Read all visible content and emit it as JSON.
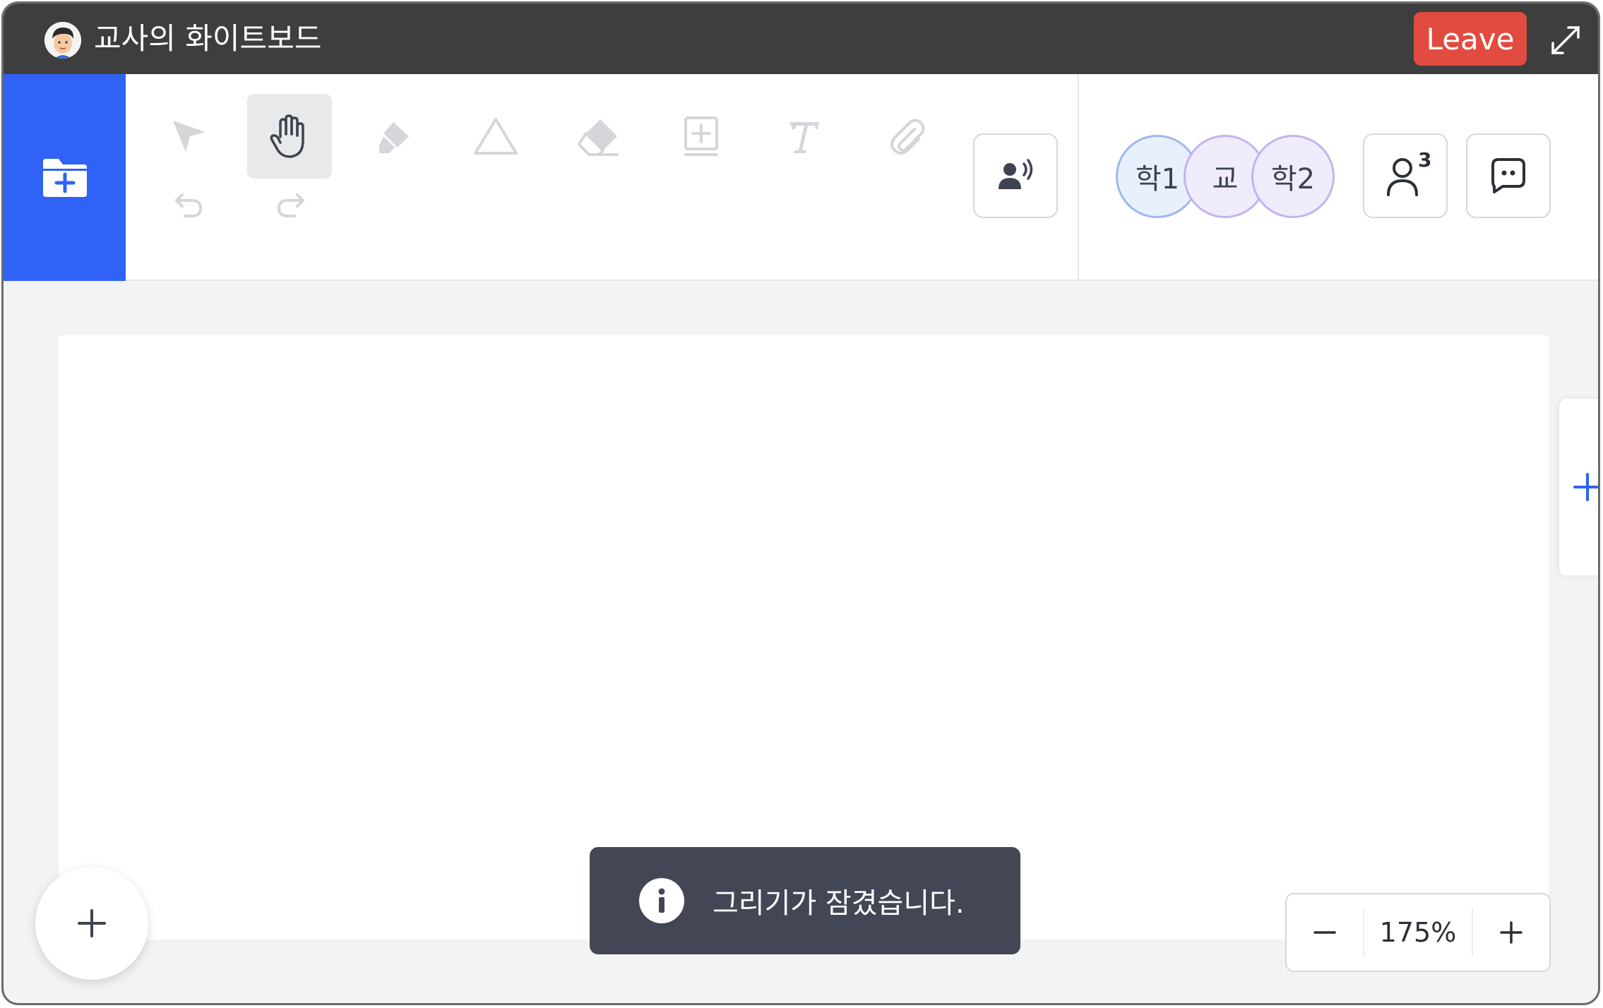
{
  "window": {
    "title": "교사의 화이트보드"
  },
  "header": {
    "leave_label": "Leave"
  },
  "toolbar": {
    "tools": [
      {
        "name": "select",
        "icon": "cursor-arrow-icon"
      },
      {
        "name": "pan",
        "icon": "hand-icon",
        "active": true
      },
      {
        "name": "highlighter",
        "icon": "highlighter-icon"
      },
      {
        "name": "shape",
        "icon": "triangle-icon"
      },
      {
        "name": "eraser",
        "icon": "eraser-icon"
      },
      {
        "name": "add-page",
        "icon": "add-page-icon"
      },
      {
        "name": "text",
        "icon": "text-icon"
      },
      {
        "name": "attach",
        "icon": "paperclip-icon"
      }
    ],
    "undo_icon": "undo-icon",
    "redo_icon": "redo-icon"
  },
  "participants": [
    {
      "label": "학1",
      "bg": "#e8f0fd",
      "border": "#9cb8ef"
    },
    {
      "label": "교",
      "bg": "#f0ecfc",
      "border": "#c4b3ee"
    },
    {
      "label": "학2",
      "bg": "#f0ecfc",
      "border": "#c4b3ee"
    }
  ],
  "participant_count": "3",
  "toast": {
    "message": "그리기가 잠겼습니다."
  },
  "zoom": {
    "value": "175%",
    "minus": "−",
    "plus": "+"
  },
  "colors": {
    "accent": "#2f62f5",
    "leave": "#e24b3f",
    "titlebar": "#3e3e3e"
  }
}
